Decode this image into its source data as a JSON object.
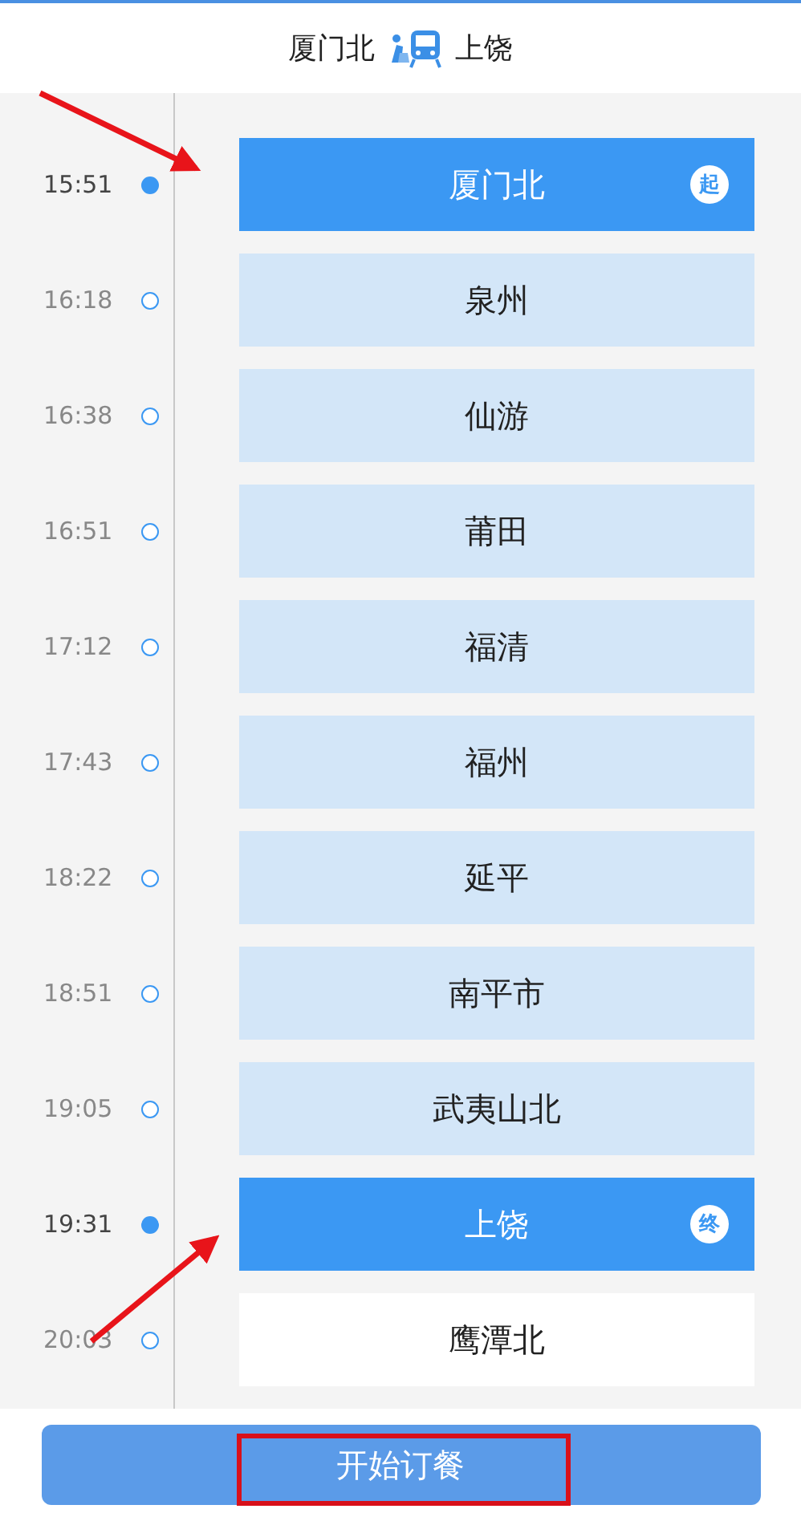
{
  "header": {
    "from": "厦门北",
    "to": "上饶"
  },
  "stops": [
    {
      "time": "15:51",
      "name": "厦门北",
      "kind": "start",
      "badge": "起"
    },
    {
      "time": "16:18",
      "name": "泉州",
      "kind": "stop"
    },
    {
      "time": "16:38",
      "name": "仙游",
      "kind": "stop"
    },
    {
      "time": "16:51",
      "name": "莆田",
      "kind": "stop"
    },
    {
      "time": "17:12",
      "name": "福清",
      "kind": "stop"
    },
    {
      "time": "17:43",
      "name": "福州",
      "kind": "stop"
    },
    {
      "time": "18:22",
      "name": "延平",
      "kind": "stop"
    },
    {
      "time": "18:51",
      "name": "南平市",
      "kind": "stop"
    },
    {
      "time": "19:05",
      "name": "武夷山北",
      "kind": "stop"
    },
    {
      "time": "19:31",
      "name": "上饶",
      "kind": "end",
      "badge": "终"
    },
    {
      "time": "20:03",
      "name": "鹰潭北",
      "kind": "outside"
    }
  ],
  "order_button": "开始订餐"
}
